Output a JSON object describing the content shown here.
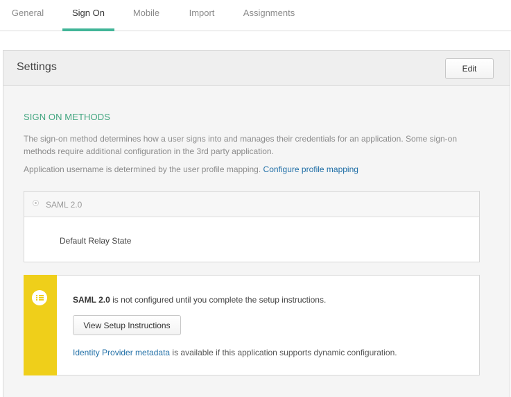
{
  "tabs": [
    {
      "label": "General",
      "active": false
    },
    {
      "label": "Sign On",
      "active": true
    },
    {
      "label": "Mobile",
      "active": false
    },
    {
      "label": "Import",
      "active": false
    },
    {
      "label": "Assignments",
      "active": false
    }
  ],
  "settings": {
    "title": "Settings",
    "edit_label": "Edit"
  },
  "sign_on_methods": {
    "title": "SIGN ON METHODS",
    "description": "The sign-on method determines how a user signs into and manages their credentials for an application. Some sign-on methods require additional configuration in the 3rd party application.",
    "username_text": "Application username is determined by the user profile mapping.",
    "configure_link": "Configure profile mapping"
  },
  "saml": {
    "option_label": "SAML 2.0",
    "relay_state_label": "Default Relay State"
  },
  "notice": {
    "bold_text": "SAML 2.0",
    "text": "is not configured until you complete the setup instructions.",
    "button_label": "View Setup Instructions",
    "metadata_link": "Identity Provider metadata",
    "metadata_text": "is available if this application supports dynamic configuration."
  },
  "colors": {
    "accent_green": "#41b598",
    "link_blue": "#1f6ea6",
    "warning_yellow": "#efcf1a"
  },
  "icons": {
    "notice_icon": "list-icon"
  }
}
